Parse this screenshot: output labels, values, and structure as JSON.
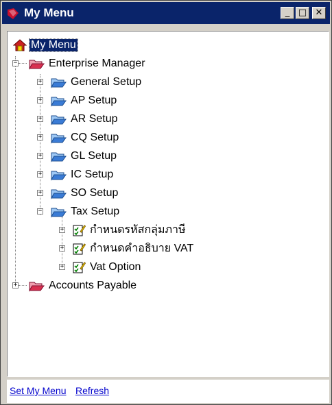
{
  "window": {
    "title": "My Menu",
    "title_icon": "mymenu-app-icon"
  },
  "titlebar_buttons": {
    "minimize": "_",
    "maximize": "□",
    "close": "✕"
  },
  "tree": {
    "root": "My Menu",
    "enterprise_manager": "Enterprise Manager",
    "general_setup": "General Setup",
    "ap_setup": "AP Setup",
    "ar_setup": "AR Setup",
    "cq_setup": "CQ Setup",
    "gl_setup": "GL Setup",
    "ic_setup": "IC Setup",
    "so_setup": "SO Setup",
    "tax_setup": "Tax Setup",
    "tax_group_code": "กำหนดรหัสกลุ่มภาษี",
    "vat_description": "กำหนดคำอธิบาย VAT",
    "vat_option": "Vat Option",
    "accounts_payable": "Accounts Payable"
  },
  "footer": {
    "set_my_menu": "Set My Menu",
    "refresh": "Refresh"
  },
  "colors": {
    "titlebar": "#0a246a",
    "link": "#0000cc",
    "folder_blue": "#3a7bd5",
    "folder_red": "#cc3344"
  }
}
